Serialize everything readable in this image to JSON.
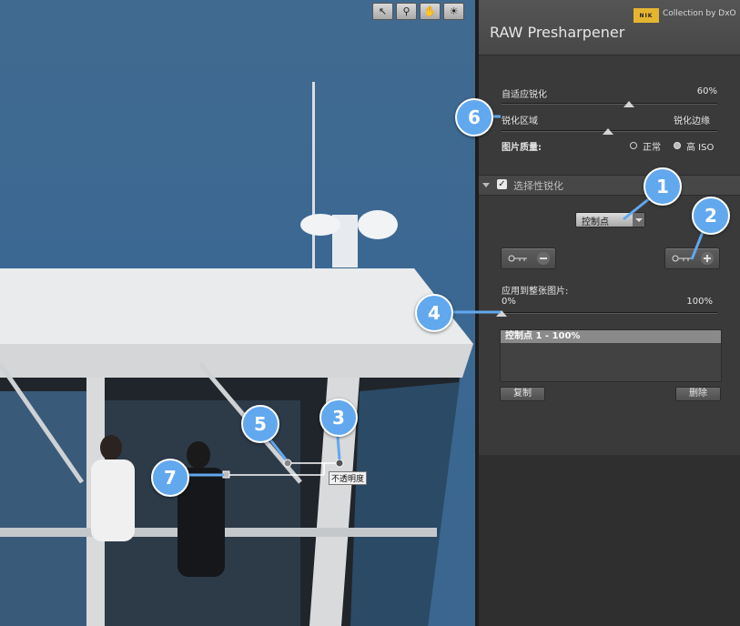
{
  "toolbar": {
    "icons": [
      "arrow-pointer-icon",
      "magnifier-icon",
      "hand-icon",
      "lightbulb-icon"
    ]
  },
  "panel": {
    "brand": "NIK",
    "collection": "Collection by DxO",
    "title": "RAW Presharpener",
    "adaptive_label": "自适应锐化",
    "adaptive_value": "60%",
    "sharpen_area_label": "锐化区域",
    "sharpen_area_value": "锐化边缘",
    "quality_label": "图片质量:",
    "quality_normal": "正常",
    "quality_high": "高 ISO",
    "selective_title": "选择性锐化",
    "select_value": "控制点",
    "apply_label": "应用到整张图片:",
    "apply_min": "0%",
    "apply_max": "100%",
    "list_items": [
      "控制点 1 - 100%"
    ],
    "copy_label": "复制",
    "delete_label": "删除"
  },
  "photo": {
    "opacity_label": "不透明度"
  },
  "callouts": [
    "1",
    "2",
    "3",
    "4",
    "5",
    "6",
    "7"
  ]
}
